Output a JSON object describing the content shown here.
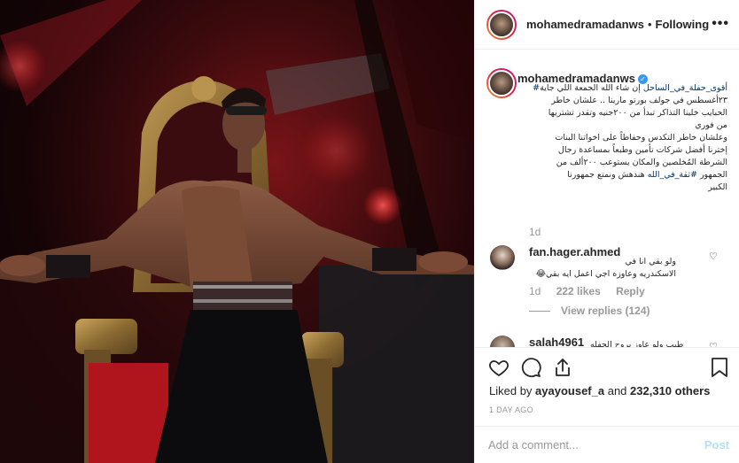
{
  "post": {
    "username": "mohamedramadanws",
    "separator": "•",
    "follow_status": "Following",
    "more_label": "•••"
  },
  "caption": {
    "username": "mohamedramadanws",
    "verified_mark": "✓",
    "line1_prefix": "#",
    "line1_tag": "أقوى_حفلة_في_الساحل",
    "line1_text": " إن شاء الله الجمعة اللي جاية",
    "line2": "٢٣أغسطس في جولف بورتو مارينا .. علشان خاطر",
    "line3": "الحبايب خلينا التذاكر تبدأ من ٢٠٠جنيه وتقدر تشتريها",
    "line4": "من فوري",
    "line5": "وعلشان خاطر التكدس وحفاظاً على اخواتنا البنات",
    "line6": "إخترنا أفضل شركات تأمين وطبعاً بمساعدة رجال",
    "line7": "الشرطة المُخلصين والمكان يستوعب ٢٠٠ألف من",
    "line8_text": "الجمهور ",
    "line8_tag": "#ثقة_في_الله",
    "line8_rest": " هندهش ونمتع جمهورنا",
    "line9": "الكبير",
    "time": "1d"
  },
  "comment1": {
    "username": "fan.hager.ahmed",
    "line1": "ولو بقي انا في",
    "line2": "الاسكندريه وعاوزه اجي اعمل ايه بقي😂",
    "time": "1d",
    "likes": "222 likes",
    "reply": "Reply",
    "view_replies": "View replies (124)"
  },
  "comment2": {
    "username": "salah4961",
    "text": "طيب ولو عاوز يروح الحفله"
  },
  "actions": {
    "liked_by_prefix": "Liked by ",
    "liked_by_user": "ayayousef_a",
    "liked_by_and": " and ",
    "liked_by_count": "232,310 others",
    "date": "1 DAY AGO",
    "comment_placeholder": "Add a comment...",
    "post_button": "Post"
  },
  "icons": {
    "heart": "heart-icon",
    "comment": "comment-icon",
    "share": "share-icon",
    "save": "bookmark-icon"
  },
  "colors": {
    "accent_blue": "#3897f0",
    "post_button_disabled": "#b2dffc",
    "muted_text": "#999999",
    "hashtag": "#003569"
  }
}
